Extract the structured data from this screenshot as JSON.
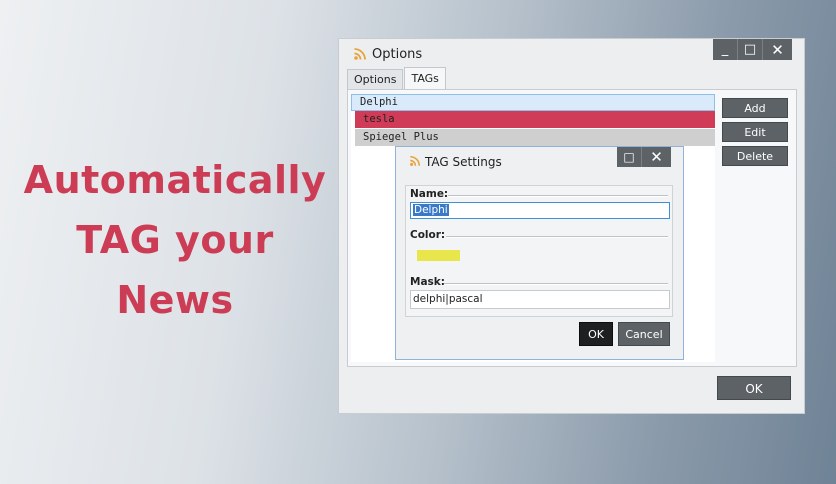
{
  "promo": {
    "line1": "Automatically",
    "line2": "TAG your",
    "line3": "News",
    "color": "#cc3d55"
  },
  "window": {
    "title": "Options",
    "icon": "rss-icon",
    "controls": {
      "minimize": "_",
      "maximize": "□",
      "close": "✕"
    },
    "tabs": [
      {
        "label": "Options",
        "active": false
      },
      {
        "label": "TAGs",
        "active": true
      }
    ],
    "tags": [
      {
        "name": "Delphi",
        "color": "#d9ebfb",
        "selected": true
      },
      {
        "name": "tesla",
        "color": "#d03b57"
      },
      {
        "name": "Spiegel Plus",
        "color": "#cfcfcf"
      }
    ],
    "buttons": {
      "add": "Add",
      "edit": "Edit",
      "delete": "Delete",
      "ok": "OK"
    }
  },
  "dialog": {
    "title": "TAG Settings",
    "icon": "rss-icon",
    "controls": {
      "maximize": "□",
      "close": "✕"
    },
    "name_label": "Name:",
    "name_value": "Delphi",
    "color_label": "Color:",
    "color_value": "#e8e64a",
    "mask_label": "Mask:",
    "mask_value": "delphi|pascal",
    "ok": "OK",
    "cancel": "Cancel"
  }
}
